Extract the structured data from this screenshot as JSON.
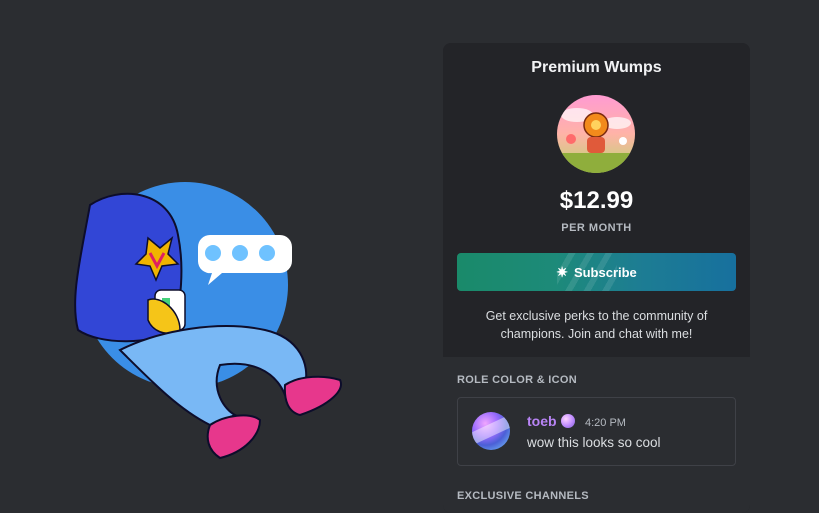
{
  "tier": {
    "name": "Premium Wumps",
    "price": "$12.99",
    "period": "PER MONTH",
    "subscribe_label": "Subscribe",
    "description": "Get exclusive perks to the community of champions. Join and chat with me!"
  },
  "sections": {
    "role_color_icon": "ROLE COLOR & ICON",
    "exclusive_channels": "EXCLUSIVE CHANNELS"
  },
  "preview_message": {
    "username": "toeb",
    "timestamp": "4:20 PM",
    "text": "wow this looks so cool",
    "username_color": "#b884f5"
  },
  "icons": [
    "sparkle-icon",
    "role-icon",
    "chat-bubble-icon"
  ],
  "colors": {
    "background": "#2b2d31",
    "card": "#232428",
    "button_gradient_start": "#1a8a6a",
    "button_gradient_end": "#17709e"
  }
}
